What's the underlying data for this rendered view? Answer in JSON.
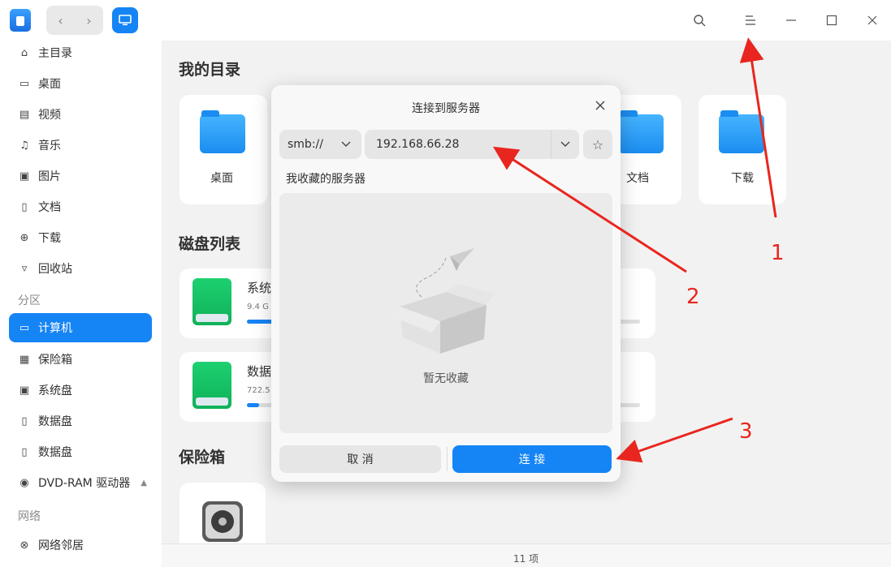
{
  "titlebar": {
    "nav_back": "‹",
    "nav_forward": "›"
  },
  "sidebar": {
    "items": [
      {
        "label": "主目录",
        "icon": "home-icon"
      },
      {
        "label": "桌面",
        "icon": "desktop-icon"
      },
      {
        "label": "视频",
        "icon": "video-icon"
      },
      {
        "label": "音乐",
        "icon": "music-icon"
      },
      {
        "label": "图片",
        "icon": "image-icon"
      },
      {
        "label": "文档",
        "icon": "document-icon"
      },
      {
        "label": "下载",
        "icon": "download-icon"
      },
      {
        "label": "回收站",
        "icon": "trash-icon"
      }
    ],
    "section_partition": "分区",
    "partition_items": [
      {
        "label": "计算机",
        "icon": "computer-icon",
        "active": true
      },
      {
        "label": "保险箱",
        "icon": "vault-icon"
      },
      {
        "label": "系统盘",
        "icon": "system-disk-icon"
      },
      {
        "label": "数据盘",
        "icon": "disk-icon"
      },
      {
        "label": "数据盘",
        "icon": "disk-icon"
      },
      {
        "label": "DVD-RAM 驱动器",
        "icon": "dvd-icon"
      }
    ],
    "section_network": "网络",
    "network_items": [
      {
        "label": "网络邻居",
        "icon": "network-icon"
      }
    ]
  },
  "main": {
    "my_dirs_title": "我的目录",
    "dirs": [
      {
        "label": "桌面"
      },
      {
        "label": "文档"
      },
      {
        "label": "下载"
      }
    ],
    "disk_list_title": "磁盘列表",
    "disks": [
      {
        "name": "系统",
        "size": "9.4 G",
        "usage_percent": 20
      },
      {
        "name": "数据",
        "size": "722.5",
        "usage_percent": 12
      }
    ],
    "vault_title": "保险箱"
  },
  "status": {
    "item_count": "11 项"
  },
  "dialog": {
    "title": "连接到服务器",
    "protocol": "smb://",
    "address": "192.168.66.28",
    "favorites_label": "我收藏的服务器",
    "empty_text": "暂无收藏",
    "cancel_label": "取 消",
    "connect_label": "连 接"
  },
  "annotations": {
    "color": "#e8261f",
    "labels": [
      "1",
      "2",
      "3"
    ]
  }
}
